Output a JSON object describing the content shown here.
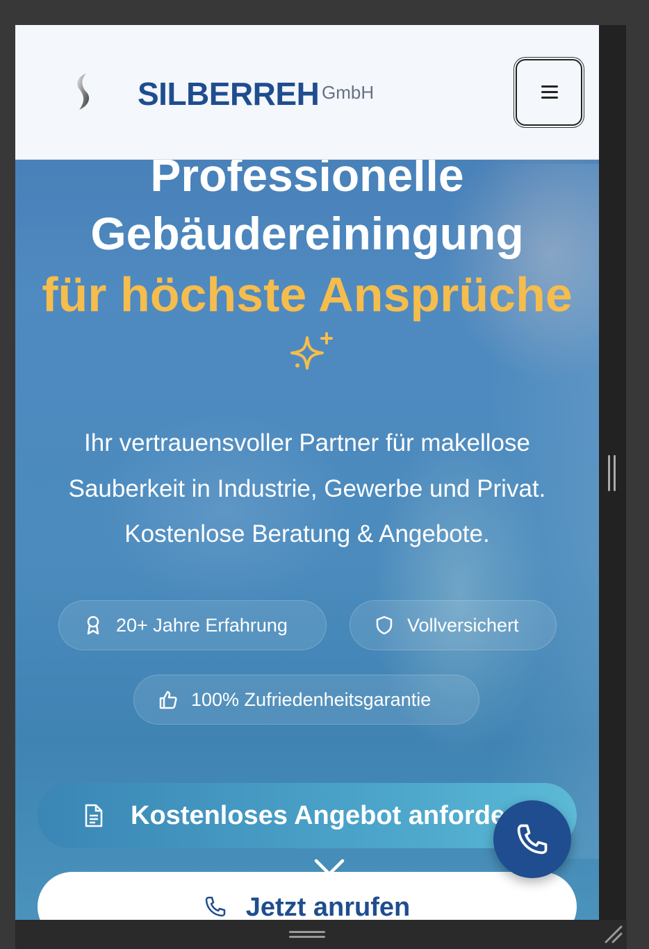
{
  "header": {
    "brand_name": "SILBERREH",
    "brand_suffix": "GmbH",
    "logo_icon": "silver-s-logo-icon",
    "menu_icon": "hamburger-menu-icon"
  },
  "hero": {
    "title_line1": "Professionelle",
    "title_line2": "Gebäudereiningung",
    "title_line3": "für höchste Ansprüche",
    "sparkle_icon": "sparkles-icon",
    "subtitle_line1": "Ihr vertrauensvoller Partner für makellose",
    "subtitle_line2": "Sauberkeit in Industrie, Gewerbe und Privat.",
    "subtitle_line3": "Kostenlose Beratung & Angebote."
  },
  "badges": [
    {
      "label": "20+ Jahre Erfahrung",
      "icon": "award-icon"
    },
    {
      "label": "Vollversichert",
      "icon": "shield-icon"
    },
    {
      "label": "100% Zufriedenheitsgarantie",
      "icon": "thumbs-up-icon"
    }
  ],
  "cta": {
    "offer_label": "Kostenloses Angebot anfordern",
    "offer_icon": "document-icon",
    "scroll_icon": "chevron-down-icon",
    "call_label": "Jetzt anrufen",
    "call_icon": "phone-icon",
    "fab_icon": "phone-icon"
  },
  "colors": {
    "brand_blue": "#1f4d8f",
    "accent_gold": "#f5bd4d",
    "header_bg": "#f4f7fb"
  }
}
